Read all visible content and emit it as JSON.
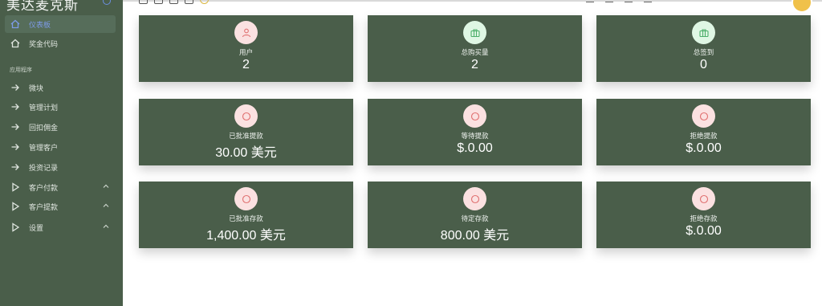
{
  "brand": {
    "title": "美达麦克斯"
  },
  "sidebar": {
    "items": [
      {
        "label": "仪表板",
        "icon": "home-icon"
      },
      {
        "label": "奖金代码",
        "icon": "home-icon"
      }
    ],
    "section_label": "应用程序",
    "apps": [
      {
        "label": "微块",
        "icon": "arrow-right-icon"
      },
      {
        "label": "管理计划",
        "icon": "arrow-right-icon"
      },
      {
        "label": "回扣佣金",
        "icon": "arrow-right-icon"
      },
      {
        "label": "管理客户",
        "icon": "arrow-right-icon"
      },
      {
        "label": "投资记录",
        "icon": "arrow-right-icon"
      },
      {
        "label": "客户付款",
        "icon": "play-icon",
        "expandable": true
      },
      {
        "label": "客户提款",
        "icon": "play-icon",
        "expandable": true
      },
      {
        "label": "设置",
        "icon": "play-icon",
        "expandable": true
      }
    ]
  },
  "cards": [
    {
      "label": "用户",
      "value": "2",
      "icon": "user-icon",
      "tone": "pink"
    },
    {
      "label": "总购买量",
      "value": "2",
      "icon": "briefcase-icon",
      "tone": "green"
    },
    {
      "label": "总签到",
      "value": "0",
      "icon": "briefcase-icon",
      "tone": "green"
    },
    {
      "label": "已批准提款",
      "value": "30.00 美元",
      "icon": "circle-icon",
      "tone": "pink"
    },
    {
      "label": "等待提款",
      "value": "$.0.00",
      "icon": "circle-icon",
      "tone": "pink"
    },
    {
      "label": "拒绝提款",
      "value": "$.0.00",
      "icon": "circle-icon",
      "tone": "pink"
    },
    {
      "label": "已批准存款",
      "value": "1,400.00 美元",
      "icon": "circle-icon",
      "tone": "pink"
    },
    {
      "label": "待定存款",
      "value": "800.00 美元",
      "icon": "circle-icon",
      "tone": "pink"
    },
    {
      "label": "拒绝存款",
      "value": "$.0.00",
      "icon": "circle-icon",
      "tone": "pink"
    }
  ]
}
